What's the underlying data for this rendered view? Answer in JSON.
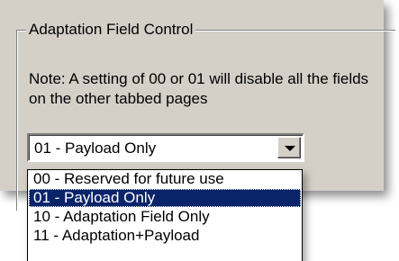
{
  "group": {
    "title": "Adaptation Field Control"
  },
  "note": {
    "text": "Note: A setting of 00 or 01 will disable all the fields on the other tabbed pages"
  },
  "combo": {
    "value": "01 - Payload Only",
    "icon": "chevron-down-icon"
  },
  "dropdown": {
    "options": [
      {
        "label": "00 - Reserved for future use",
        "selected": false
      },
      {
        "label": "01 - Payload Only",
        "selected": true
      },
      {
        "label": "10 - Adaptation Field Only",
        "selected": false
      },
      {
        "label": "11 - Adaptation+Payload",
        "selected": false
      }
    ]
  },
  "colors": {
    "panel": "#d4d0c8",
    "selection": "#0a246a",
    "selection_text": "#ffffff"
  }
}
